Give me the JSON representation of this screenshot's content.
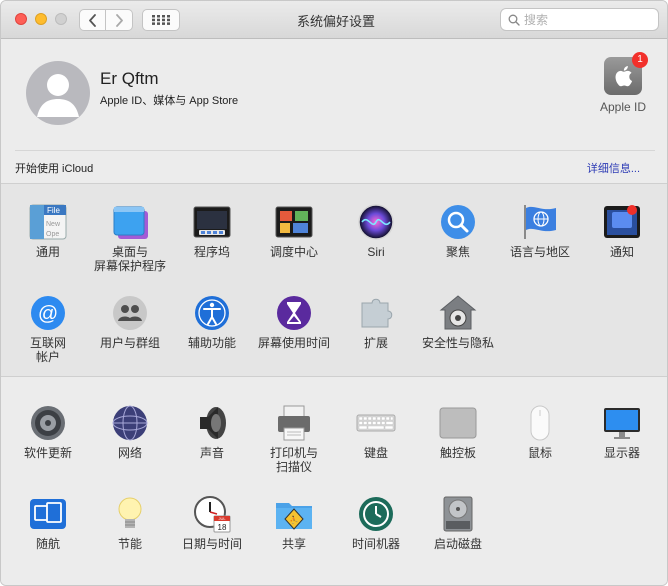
{
  "window": {
    "title": "系统偏好设置",
    "search_placeholder": "搜索"
  },
  "account": {
    "name": "Er Qftm",
    "subtitle": "Apple ID、媒体与 App Store",
    "apple_id_label": "Apple ID",
    "apple_id_badge": "1",
    "icloud_prompt": "开始使用 iCloud",
    "details_link": "详细信息..."
  },
  "row1": [
    {
      "label": "通用",
      "icon": "general-icon"
    },
    {
      "label": "桌面与\n屏幕保护程序",
      "icon": "desktop-screensaver-icon"
    },
    {
      "label": "程序坞",
      "icon": "dock-icon"
    },
    {
      "label": "调度中心",
      "icon": "mission-control-icon"
    },
    {
      "label": "Siri",
      "icon": "siri-icon"
    },
    {
      "label": "聚焦",
      "icon": "spotlight-icon"
    },
    {
      "label": "语言与地区",
      "icon": "language-region-icon"
    },
    {
      "label": "通知",
      "icon": "notifications-icon"
    }
  ],
  "row2": [
    {
      "label": "互联网\n帐户",
      "icon": "internet-accounts-icon"
    },
    {
      "label": "用户与群组",
      "icon": "users-groups-icon"
    },
    {
      "label": "辅助功能",
      "icon": "accessibility-icon"
    },
    {
      "label": "屏幕使用时间",
      "icon": "screen-time-icon"
    },
    {
      "label": "扩展",
      "icon": "extensions-icon"
    },
    {
      "label": "安全性与隐私",
      "icon": "security-privacy-icon"
    }
  ],
  "row3": [
    {
      "label": "软件更新",
      "icon": "software-update-icon"
    },
    {
      "label": "网络",
      "icon": "network-icon"
    },
    {
      "label": "声音",
      "icon": "sound-icon"
    },
    {
      "label": "打印机与\n扫描仪",
      "icon": "printers-scanners-icon"
    },
    {
      "label": "键盘",
      "icon": "keyboard-icon"
    },
    {
      "label": "触控板",
      "icon": "trackpad-icon"
    },
    {
      "label": "鼠标",
      "icon": "mouse-icon"
    },
    {
      "label": "显示器",
      "icon": "displays-icon"
    }
  ],
  "row4": [
    {
      "label": "随航",
      "icon": "sidecar-icon"
    },
    {
      "label": "节能",
      "icon": "energy-saver-icon"
    },
    {
      "label": "日期与时间",
      "icon": "date-time-icon"
    },
    {
      "label": "共享",
      "icon": "sharing-icon"
    },
    {
      "label": "时间机器",
      "icon": "time-machine-icon"
    },
    {
      "label": "启动磁盘",
      "icon": "startup-disk-icon"
    }
  ],
  "date_time_icon": {
    "month": "JUL",
    "day": "18"
  }
}
